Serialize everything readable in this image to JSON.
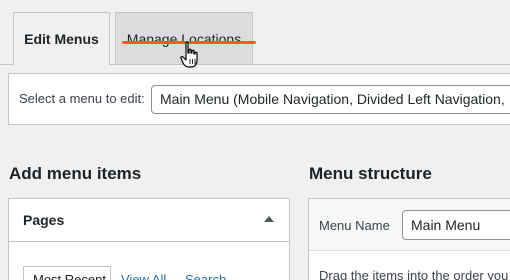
{
  "tabs": [
    {
      "label": "Edit Menus",
      "active": true
    },
    {
      "label": "Manage Locations",
      "active": false
    }
  ],
  "select_menu": {
    "label": "Select a menu to edit:",
    "value": "Main Menu (Mobile Navigation, Divided Left Navigation,"
  },
  "add_menu_items": {
    "heading": "Add menu items",
    "pages_panel": {
      "title": "Pages",
      "subtabs": [
        "Most Recent",
        "View All",
        "Search"
      ]
    }
  },
  "menu_structure": {
    "heading": "Menu structure",
    "menu_name_label": "Menu Name",
    "menu_name_value": "Main Menu",
    "drag_text": "Drag the items into the order you"
  },
  "colors": {
    "accent_underline": "#ff5a1f",
    "link": "#2271b1"
  },
  "cursor_icon": "hand-pointer-icon"
}
